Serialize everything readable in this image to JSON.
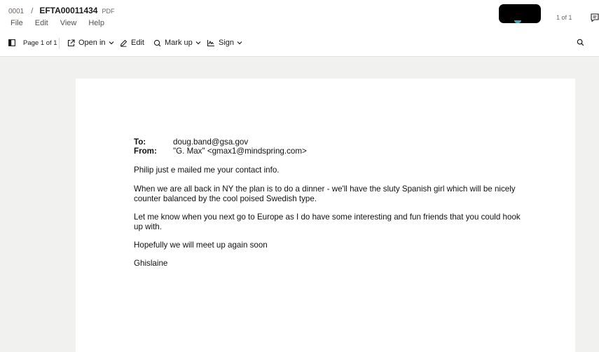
{
  "breadcrumb": {
    "folder": "0001",
    "separator": "/",
    "file_name": "EFTA00011434",
    "file_type": "PDF"
  },
  "menu": [
    "File",
    "Edit",
    "View",
    "Help"
  ],
  "page_counter": "1 of 1",
  "toolbar": {
    "page_indicator": "Page 1 of 1",
    "open_in": "Open in",
    "edit": "Edit",
    "mark_up": "Mark up",
    "sign": "Sign"
  },
  "email": {
    "to_label": "To:",
    "to_value": "doug.band@gsa.gov",
    "from_label": "From:",
    "from_value": "\"G. Max\" <gmax1@mindspring.com>",
    "paragraphs": [
      "Philip just e mailed me your contact info.",
      "When we are all back in NY the plan is to do a dinner - we'll have the sluty Spanish girl which will be nicely counter balanced by the cool poised Swedish type.",
      "Let me know when you next go to Europe as I do have some interesting and fun friends that you could hook up with.",
      "Hopefully we will meet up again soon",
      "Ghislaine"
    ]
  },
  "icons": {
    "sidebar": "sidebar-toggle-icon",
    "open_in": "external-link-icon",
    "edit": "pencil-icon",
    "mark_up": "markup-pen-icon",
    "sign": "signature-icon",
    "search": "search-icon",
    "comment": "comment-icon"
  },
  "colors": {
    "page_bg": "#f1f1ef",
    "toolbar_bg": "#ffffff",
    "text": "#1e1919",
    "muted": "#6b6561"
  }
}
